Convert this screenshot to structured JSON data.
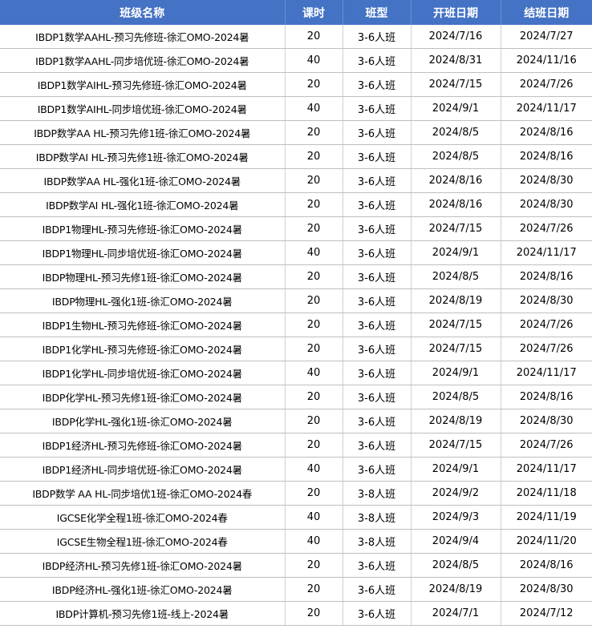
{
  "table": {
    "headers": [
      "班级名称",
      "课时",
      "班型",
      "开班日期",
      "结班日期"
    ],
    "rows": [
      [
        "IBDP1数学AAHL-预习先修班-徐汇OMO-2024暑",
        "20",
        "3-6人班",
        "2024/7/16",
        "2024/7/27"
      ],
      [
        "IBDP1数学AAHL-同步培优班-徐汇OMO-2024暑",
        "40",
        "3-6人班",
        "2024/8/31",
        "2024/11/16"
      ],
      [
        "IBDP1数学AIHL-预习先修班-徐汇OMO-2024暑",
        "20",
        "3-6人班",
        "2024/7/15",
        "2024/7/26"
      ],
      [
        "IBDP1数学AIHL-同步培优班-徐汇OMO-2024暑",
        "40",
        "3-6人班",
        "2024/9/1",
        "2024/11/17"
      ],
      [
        "IBDP数学AA HL-预习先修1班-徐汇OMO-2024暑",
        "20",
        "3-6人班",
        "2024/8/5",
        "2024/8/16"
      ],
      [
        "IBDP数学AI HL-预习先修1班-徐汇OMO-2024暑",
        "20",
        "3-6人班",
        "2024/8/5",
        "2024/8/16"
      ],
      [
        "IBDP数学AA HL-强化1班-徐汇OMO-2024暑",
        "20",
        "3-6人班",
        "2024/8/16",
        "2024/8/30"
      ],
      [
        "IBDP数学AI HL-强化1班-徐汇OMO-2024暑",
        "20",
        "3-6人班",
        "2024/8/16",
        "2024/8/30"
      ],
      [
        "IBDP1物理HL-预习先修班-徐汇OMO-2024暑",
        "20",
        "3-6人班",
        "2024/7/15",
        "2024/7/26"
      ],
      [
        "IBDP1物理HL-同步培优班-徐汇OMO-2024暑",
        "40",
        "3-6人班",
        "2024/9/1",
        "2024/11/17"
      ],
      [
        "IBDP物理HL-预习先修1班-徐汇OMO-2024暑",
        "20",
        "3-6人班",
        "2024/8/5",
        "2024/8/16"
      ],
      [
        "IBDP物理HL-强化1班-徐汇OMO-2024暑",
        "20",
        "3-6人班",
        "2024/8/19",
        "2024/8/30"
      ],
      [
        "IBDP1生物HL-预习先修班-徐汇OMO-2024暑",
        "20",
        "3-6人班",
        "2024/7/15",
        "2024/7/26"
      ],
      [
        "IBDP1化学HL-预习先修班-徐汇OMO-2024暑",
        "20",
        "3-6人班",
        "2024/7/15",
        "2024/7/26"
      ],
      [
        "IBDP1化学HL-同步培优班-徐汇OMO-2024暑",
        "40",
        "3-6人班",
        "2024/9/1",
        "2024/11/17"
      ],
      [
        "IBDP化学HL-预习先修1班-徐汇OMO-2024暑",
        "20",
        "3-6人班",
        "2024/8/5",
        "2024/8/16"
      ],
      [
        "IBDP化学HL-强化1班-徐汇OMO-2024暑",
        "20",
        "3-6人班",
        "2024/8/19",
        "2024/8/30"
      ],
      [
        "IBDP1经济HL-预习先修班-徐汇OMO-2024暑",
        "20",
        "3-6人班",
        "2024/7/15",
        "2024/7/26"
      ],
      [
        "IBDP1经济HL-同步培优班-徐汇OMO-2024暑",
        "40",
        "3-6人班",
        "2024/9/1",
        "2024/11/17"
      ],
      [
        "IBDP数学 AA HL-同步培优1班-徐汇OMO-2024春",
        "20",
        "3-8人班",
        "2024/9/2",
        "2024/11/18"
      ],
      [
        "IGCSE化学全程1班-徐汇OMO-2024春",
        "40",
        "3-8人班",
        "2024/9/3",
        "2024/11/19"
      ],
      [
        "IGCSE生物全程1班-徐汇OMO-2024春",
        "40",
        "3-8人班",
        "2024/9/4",
        "2024/11/20"
      ],
      [
        "IBDP经济HL-预习先修1班-徐汇OMO-2024暑",
        "20",
        "3-6人班",
        "2024/8/5",
        "2024/8/16"
      ],
      [
        "IBDP经济HL-强化1班-徐汇OMO-2024暑",
        "20",
        "3-6人班",
        "2024/8/19",
        "2024/8/30"
      ],
      [
        "IBDP计算机-预习先修1班-线上-2024暑",
        "20",
        "3-6人班",
        "2024/7/1",
        "2024/7/12"
      ]
    ]
  }
}
